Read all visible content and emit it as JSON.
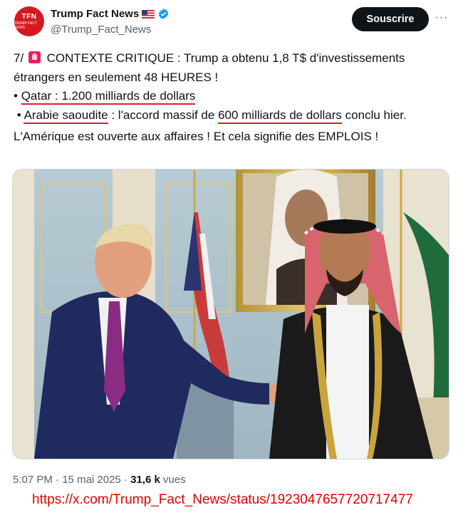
{
  "account": {
    "avatar_text": "TFN",
    "avatar_subtext": "TRUMP FACT NEWS",
    "display_name": "Trump Fact News",
    "handle": "@Trump_Fact_News"
  },
  "actions": {
    "subscribe_label": "Souscrire",
    "more_label": "···"
  },
  "tweet": {
    "line1_prefix": "7/",
    "line1_text": "CONTEXTE CRITIQUE : Trump a obtenu 1,8 T$ d'investissements étrangers en seulement 48 HEURES !",
    "bullet": "•",
    "qatar_label": "Qatar : 1.200 milliards de dollars",
    "saudi_label": "Arabie saoudite",
    "saudi_middle": ": l'accord massif de",
    "saudi_amount": "600 milliards de dollars",
    "saudi_tail": "conclu hier.",
    "closing": "L'Amérique est ouverte aux affaires ! Et cela signifie des EMPLOIS !"
  },
  "meta": {
    "time": "5:07 PM",
    "separator": "·",
    "date": "15 mai 2025",
    "views_count": "31,6 k",
    "views_label": "vues"
  },
  "source_url": "https://x.com/Trump_Fact_News/status/1923047657720717477",
  "colors": {
    "avatar_bg": "#d7191f",
    "underline": "#e02020",
    "verified": "#1d9bf0",
    "url": "#e00000"
  }
}
